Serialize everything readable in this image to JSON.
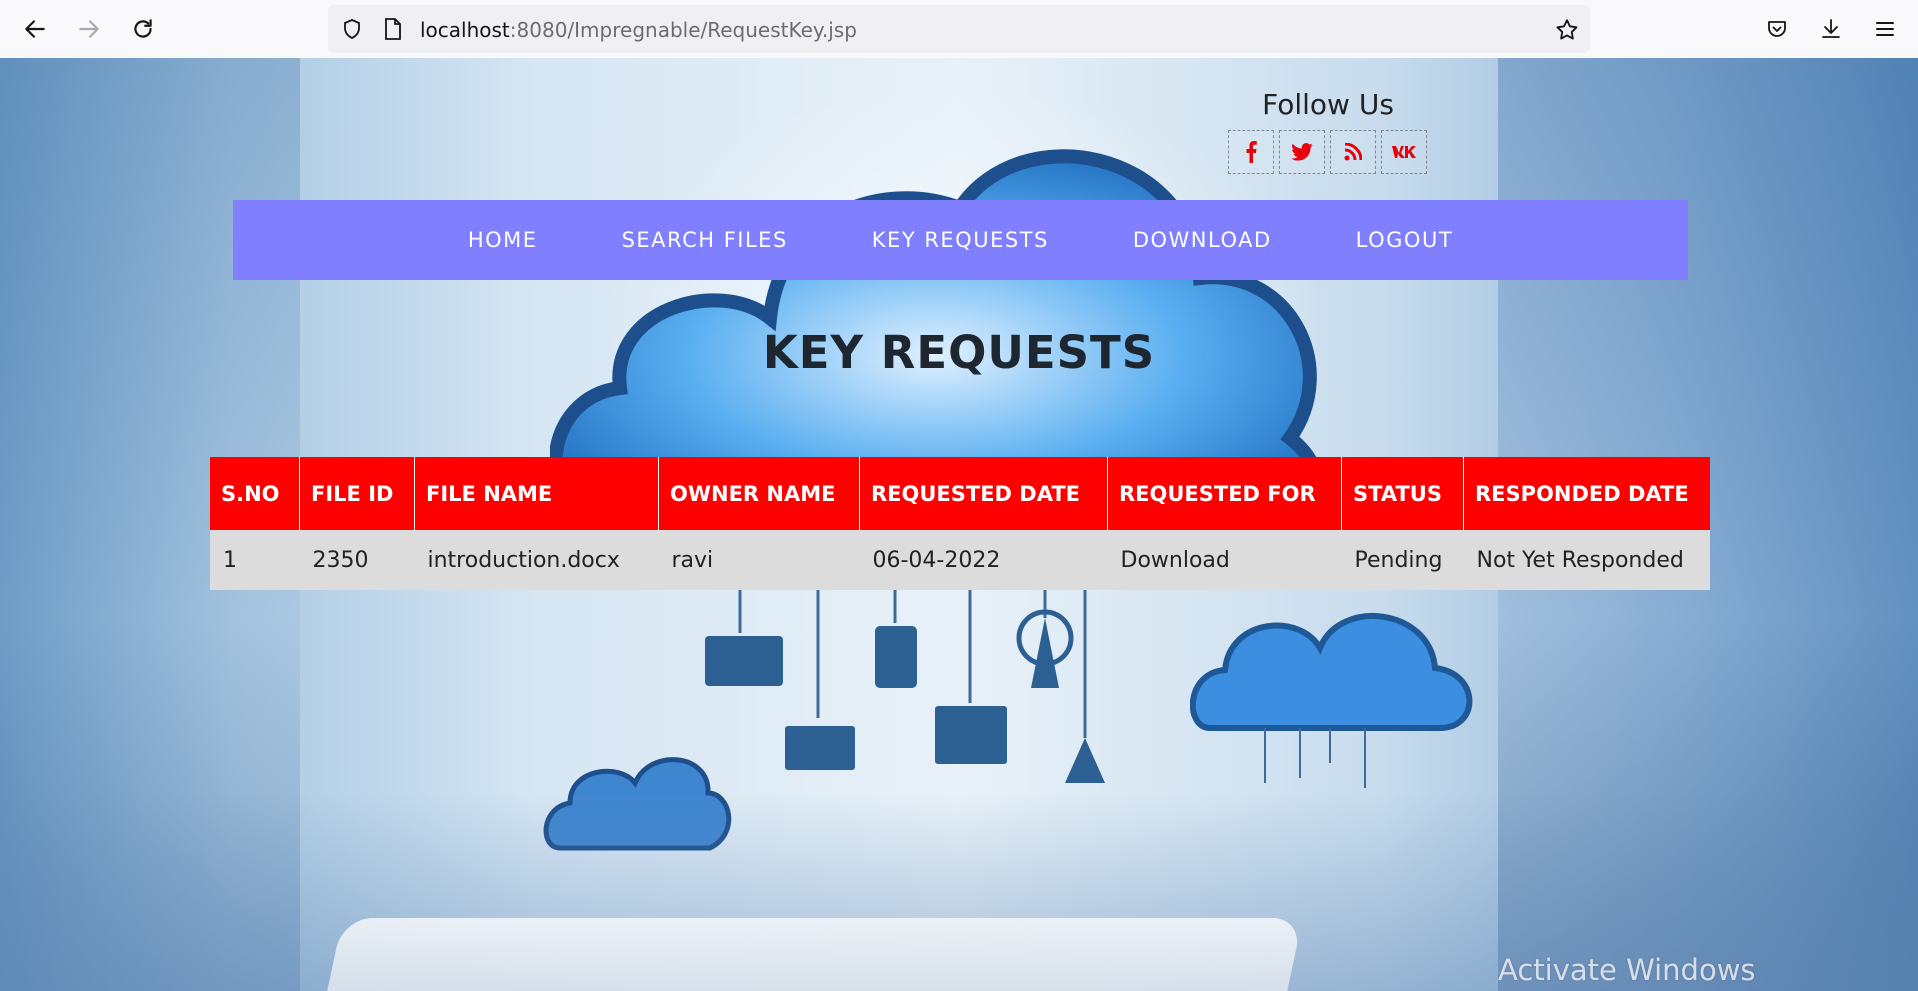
{
  "browser": {
    "url_host": "localhost",
    "url_path": ":8080/Impregnable/RequestKey.jsp"
  },
  "follow": {
    "title": "Follow Us",
    "icons": [
      "facebook-icon",
      "twitter-icon",
      "rss-icon",
      "vk-icon"
    ],
    "glyphs": [
      "f",
      "t",
      "r",
      "vk"
    ]
  },
  "menu": {
    "items": [
      "HOME",
      "SEARCH FILES",
      "KEY REQUESTS",
      "DOWNLOAD",
      "LOGOUT"
    ]
  },
  "page_title": "KEY REQUESTS",
  "table": {
    "headers": [
      "S.NO",
      "FILE ID",
      "FILE NAME",
      "OWNER NAME",
      "REQUESTED DATE",
      "REQUESTED FOR",
      "STATUS",
      "RESPONDED DATE"
    ],
    "rows": [
      [
        "1",
        "2350",
        "introduction.docx",
        "ravi",
        "06-04-2022",
        "Download",
        "Pending",
        "Not Yet Responded"
      ]
    ]
  },
  "watermark": "Activate Windows",
  "colors": {
    "menu_bg": "#7f7fff",
    "table_header_bg": "#ff0000",
    "table_row_bg": "#dcdcdc",
    "social_icon": "#e8000a"
  }
}
